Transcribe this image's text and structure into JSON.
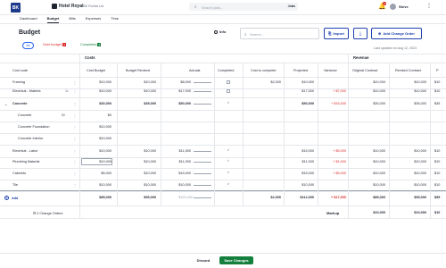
{
  "topbar": {
    "logo": "BK",
    "project_name": "Hotel Royal",
    "project_sub": "456 Florida Ltd",
    "search_placeholder": "Search jobs...",
    "search_scope": "Jobs",
    "notification_count": "2",
    "user_name": "Steve"
  },
  "nav": {
    "items": [
      "Dashboard",
      "Budget",
      "Bills",
      "Expenses",
      "Time"
    ],
    "active": "Budget"
  },
  "header": {
    "title": "Budget",
    "info_label": "Info",
    "search_placeholder": "Search...",
    "import_label": "Import",
    "add_change_order_label": "Add Change Order",
    "last_updated": "Last updated on Aug 12, 2023"
  },
  "filters": {
    "all": "All",
    "over_budget": "Over budget",
    "over_budget_count": "3",
    "completed": "Completed",
    "completed_count": "4"
  },
  "sections": {
    "costs": "Costs",
    "revenue": "Revenue"
  },
  "columns": [
    "Cost code",
    "Cost Budget",
    "Budget Revised",
    "Actuals",
    "Completed",
    "Cost to complete",
    "Projected",
    "Variance",
    "Original Contract",
    "Revised Contract",
    "P"
  ],
  "rows": [
    {
      "name": "Framing",
      "budget": "$10,000",
      "revised": "$10,000",
      "actual": "$8,000",
      "completed": false,
      "ctc": "$2,000",
      "projected": "$10,000",
      "variance": "",
      "orig": "$10,000",
      "rev": "$10,000",
      "p": "$10"
    },
    {
      "name": "Electrical - Materia",
      "badge": "1L",
      "budget": "$10,000",
      "revised": "$10,000",
      "actual": "$17,000",
      "completed": false,
      "ctc": "",
      "projected": "$17,000",
      "variance": "+ $7,000",
      "orig": "$10,000",
      "rev": "$10,000",
      "p": "$10"
    },
    {
      "name": "Concrete",
      "budget": "$30,000",
      "revised": "$35,000",
      "actual": "$50,000",
      "completed": true,
      "ctc": "",
      "projected": "$50,000",
      "variance": "+ $15,000",
      "orig": "$30,000",
      "rev": "$35,000",
      "p": "$35"
    },
    {
      "name": "Concrete",
      "badge": "$0",
      "budget": "$0",
      "revised": "",
      "actual": "",
      "completed": null,
      "ctc": "",
      "projected": "",
      "variance": "",
      "orig": "",
      "rev": "",
      "p": ""
    },
    {
      "name": "Concrete Foundation",
      "budget": "$10,000",
      "revised": "",
      "actual": "",
      "completed": null,
      "ctc": "",
      "projected": "",
      "variance": "",
      "orig": "",
      "rev": "",
      "p": ""
    },
    {
      "name": "Concrete Interior",
      "budget": "$10,000",
      "revised": "",
      "actual": "",
      "completed": null,
      "ctc": "",
      "projected": "",
      "variance": "",
      "orig": "",
      "rev": "",
      "p": ""
    },
    {
      "name": "Electrical - Labor",
      "budget": "$10,000",
      "revised": "$10,000",
      "actual": "$11,500",
      "completed": true,
      "ctc": "",
      "projected": "$15,000",
      "variance": "+ $5,000",
      "orig": "$10,000",
      "rev": "$10,000",
      "p": "$10"
    },
    {
      "name": "Plumbing Material",
      "budget": "$10,000",
      "revised": "$10,000",
      "actual": "$11,000",
      "completed": true,
      "ctc": "",
      "projected": "$11,000",
      "variance": "+ $1,000",
      "orig": "$10,000",
      "rev": "$10,000",
      "p": "$10"
    },
    {
      "name": "Cabinets",
      "budget": "$5,000",
      "revised": "$10,000",
      "actual": "$15,000",
      "completed": true,
      "ctc": "",
      "projected": "$15,000",
      "variance": "+ $5,000",
      "orig": "$10,000",
      "rev": "$10,000",
      "p": "$10"
    },
    {
      "name": "Tile",
      "budget": "$10,000",
      "revised": "$10,000",
      "actual": "$10,000",
      "completed": true,
      "ctc": "",
      "projected": "$10,000",
      "variance": "",
      "orig": "$10,000",
      "rev": "$10,000",
      "p": "$10"
    }
  ],
  "totals": {
    "budget": "$85,000",
    "revised": "$95,000",
    "actual": "$120,000",
    "ctc": "$2,000",
    "projected": "$112,000",
    "variance": "+ $17,000",
    "orig": "$85,000",
    "rev": "$95,000",
    "p": "$95"
  },
  "add_label": "Add",
  "change_orders": "2 Change Orders",
  "markup": {
    "label": "Markup",
    "orig": "$10,000",
    "rev": "$10,000",
    "p": "$10"
  },
  "footer": {
    "discard": "Discard",
    "save": "Save Changes"
  }
}
